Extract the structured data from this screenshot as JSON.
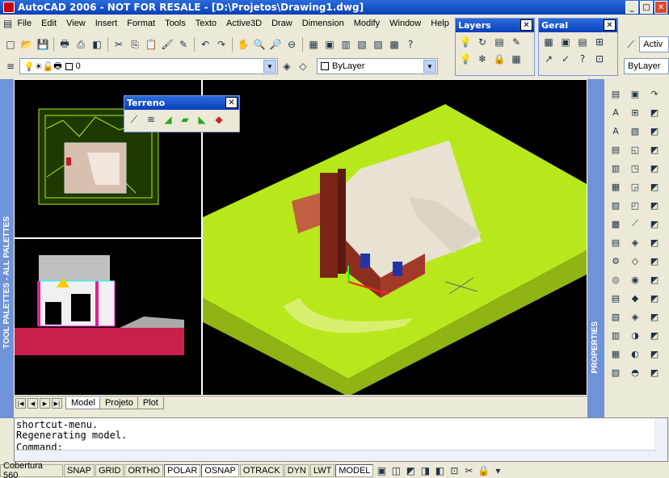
{
  "window": {
    "title": "AutoCAD 2006 - NOT FOR RESALE - [D:\\Projetos\\Drawing1.dwg]"
  },
  "menu": [
    "File",
    "Edit",
    "View",
    "Insert",
    "Format",
    "Tools",
    "Texto",
    "Active3D",
    "Draw",
    "Dimension",
    "Modify",
    "Window",
    "Help"
  ],
  "layer_combo": {
    "value": "0"
  },
  "color_combo": {
    "value": "ByLayer"
  },
  "linetype_combo": {
    "value": "ByLayer"
  },
  "right_combo": {
    "value": "Activ"
  },
  "panels": {
    "layers": "Layers",
    "geral": "Geral",
    "terreno": "Terreno"
  },
  "palette_labels": {
    "left": "TOOL PALETTES - ALL PALETTES",
    "right": "PROPERTIES"
  },
  "tabs": [
    "Model",
    "Projeto",
    "Plot"
  ],
  "active_tab": "Model",
  "command": {
    "lines": [
      "shortcut-menu.",
      "Regenerating model."
    ],
    "prompt": "Command:"
  },
  "status": {
    "coords": "Cobertura 560",
    "toggles": [
      "SNAP",
      "GRID",
      "ORTHO",
      "POLAR",
      "OSNAP",
      "OTRACK",
      "DYN",
      "LWT",
      "MODEL"
    ],
    "on": [
      "POLAR",
      "OSNAP",
      "MODEL"
    ]
  },
  "colors": {
    "terrain": "#b8e81c",
    "background": "#000000",
    "wall": "#8a2f20",
    "roof": "#e8e2d2"
  },
  "icons": {
    "app": "autocad-logo-icon",
    "close": "close-icon"
  }
}
